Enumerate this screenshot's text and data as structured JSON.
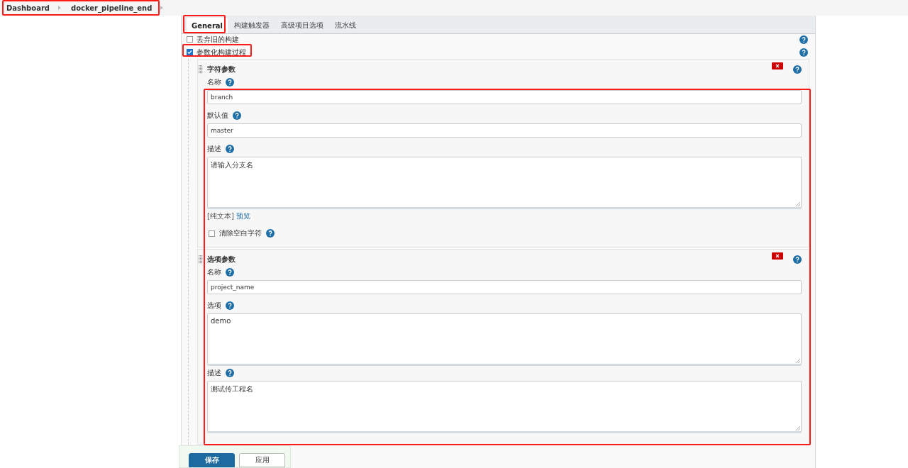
{
  "breadcrumb": [
    {
      "label": "Dashboard"
    },
    {
      "label": "docker_pipeline_end"
    }
  ],
  "tabs": [
    {
      "label": "General",
      "selected": true
    },
    {
      "label": "构建触发器",
      "selected": false
    },
    {
      "label": "高级项目选项",
      "selected": false
    },
    {
      "label": "流水线",
      "selected": false
    }
  ],
  "options": [
    {
      "label": "丢弃旧的构建",
      "checked": false
    },
    {
      "label": "参数化构建过程",
      "checked": true
    }
  ],
  "parameters": [
    {
      "title": "字符参数",
      "fields": [
        {
          "kind": "input",
          "label": "名称",
          "value": "branch"
        },
        {
          "kind": "input",
          "label": "默认值",
          "value": "master"
        },
        {
          "kind": "textarea",
          "label": "描述",
          "value": "请输入分支名"
        }
      ],
      "format": {
        "mode": "[纯文本]",
        "preview": "预览"
      },
      "trim": {
        "label": "清除空白字符",
        "checked": false
      }
    },
    {
      "title": "选项参数",
      "fields": [
        {
          "kind": "input",
          "label": "名称",
          "value": "project_name"
        },
        {
          "kind": "textarea",
          "label": "选项",
          "value": "demo"
        },
        {
          "kind": "textarea",
          "label": "描述",
          "value": "测试传工程名"
        }
      ]
    }
  ],
  "buttons": [
    {
      "label": "保存",
      "kind": "primary"
    },
    {
      "label": "应用",
      "kind": "secondary"
    }
  ]
}
